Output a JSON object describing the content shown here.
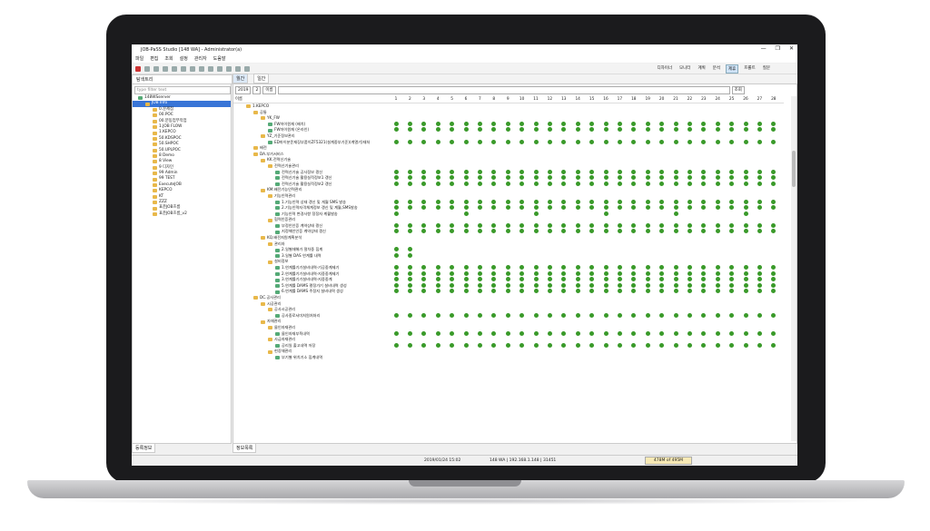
{
  "window": {
    "title": "JOB-PaSS Studio [148 WA] - Administrator(a)",
    "min": "—",
    "max": "❐",
    "close": "✕"
  },
  "menu": [
    "파일",
    "편집",
    "조회",
    "설정",
    "관리자",
    "도움말"
  ],
  "perspectives": [
    {
      "label": "디자이너",
      "active": false
    },
    {
      "label": "모니터",
      "active": false
    },
    {
      "label": "계획",
      "active": false
    },
    {
      "label": "분석",
      "active": false
    },
    {
      "label": "제휴",
      "active": true
    },
    {
      "label": "프롤트",
      "active": false
    },
    {
      "label": "질문",
      "active": false
    }
  ],
  "left_tab": {
    "label": "탐색트리"
  },
  "left_filter": {
    "placeholder": "type filter text"
  },
  "tree": [
    {
      "label": "148WSserver",
      "level": 0,
      "type": "server"
    },
    {
      "label": "JOB Info",
      "level": 1,
      "type": "folder",
      "selected": true
    },
    {
      "label": "0.문제점",
      "level": 2,
      "type": "folder"
    },
    {
      "label": "00.POC",
      "level": 2,
      "type": "folder"
    },
    {
      "label": "00.분동업무작업",
      "level": 2,
      "type": "folder"
    },
    {
      "label": "1.JOB FLOW",
      "level": 2,
      "type": "folder"
    },
    {
      "label": "1.KEPCO",
      "level": 2,
      "type": "folder"
    },
    {
      "label": "50.KDSPOC",
      "level": 2,
      "type": "folder"
    },
    {
      "label": "50.SHPOC",
      "level": 2,
      "type": "folder"
    },
    {
      "label": "50.UPLPOC",
      "level": 2,
      "type": "folder"
    },
    {
      "label": "8 Demo",
      "level": 2,
      "type": "folder"
    },
    {
      "label": "8 View",
      "level": 2,
      "type": "folder"
    },
    {
      "label": "9 디자인",
      "level": 2,
      "type": "folder"
    },
    {
      "label": "99 Admin",
      "level": 2,
      "type": "folder"
    },
    {
      "label": "99 TEST",
      "level": 2,
      "type": "folder"
    },
    {
      "label": "ExecuteJOB",
      "level": 2,
      "type": "folder"
    },
    {
      "label": "KEPCO",
      "level": 2,
      "type": "folder"
    },
    {
      "label": "KT",
      "level": 2,
      "type": "folder"
    },
    {
      "label": "ZZZ",
      "level": 2,
      "type": "folder"
    },
    {
      "label": "표준JOB흐름",
      "level": 2,
      "type": "folder"
    },
    {
      "label": "표준JOB흐름_v2",
      "level": 2,
      "type": "folder"
    }
  ],
  "main_tabs": [
    {
      "label": "월간",
      "active": true
    },
    {
      "label": "일간",
      "active": false
    }
  ],
  "filters": {
    "year": "2019",
    "month": "2",
    "scope": "이름",
    "search_button": "조회"
  },
  "grid": {
    "name_header": "이름",
    "days": [
      "1",
      "2",
      "3",
      "4",
      "5",
      "6",
      "7",
      "8",
      "9",
      "10",
      "11",
      "12",
      "13",
      "14",
      "15",
      "16",
      "17",
      "18",
      "19",
      "20",
      "21",
      "22",
      "23",
      "24",
      "25",
      "26",
      "27",
      "28"
    ],
    "rows": [
      {
        "label": "1.KEPCO",
        "level": 0,
        "type": "folder",
        "marks": ""
      },
      {
        "label": "공통",
        "level": 1,
        "type": "folder",
        "marks": ""
      },
      {
        "label": "YK_FW",
        "level": 2,
        "type": "folder",
        "marks": ""
      },
      {
        "label": "FW마이원재 (배치)",
        "level": 3,
        "type": "job",
        "marks": "1111111111111111111111111111"
      },
      {
        "label": "FW마이원재 (온라인)",
        "level": 3,
        "type": "job",
        "marks": "1111111111111111111111111111"
      },
      {
        "label": "YZ_기준정보관리",
        "level": 2,
        "type": "folder",
        "marks": ""
      },
      {
        "label": "ED마이분운재징부품이ZF5321(설계중부기준)(계열기)재처",
        "level": 3,
        "type": "job",
        "marks": "1111111111111111111111111111"
      },
      {
        "label": "배전",
        "level": 1,
        "type": "folder",
        "marks": ""
      },
      {
        "label": "DA.부가서비스",
        "level": 1,
        "type": "folder",
        "marks": ""
      },
      {
        "label": "KK.전력신기술",
        "level": 2,
        "type": "folder",
        "marks": ""
      },
      {
        "label": "전력신기술관리",
        "level": 3,
        "type": "folder",
        "marks": ""
      },
      {
        "label": "전력신기술 공사정보 갱신",
        "level": 4,
        "type": "job",
        "marks": "1111111111111111111111111111"
      },
      {
        "label": "전력신기술 활용실적정보1 갱신",
        "level": 4,
        "type": "job",
        "marks": "1111111111111111111111111111"
      },
      {
        "label": "전력신기술 활용실적정보2 갱신",
        "level": 4,
        "type": "job",
        "marks": "1111111111111111111111111111"
      },
      {
        "label": "KM.배전기능인력관리",
        "level": 2,
        "type": "folder",
        "marks": ""
      },
      {
        "label": "기능인력관리",
        "level": 3,
        "type": "folder",
        "marks": ""
      },
      {
        "label": "1.기능인력 상태 갱신 및 게월 SMS 발송",
        "level": 4,
        "type": "job",
        "marks": "1111111111111111111111111111"
      },
      {
        "label": "2.기능인력자격체계정보 갱신 및 계월,SMS발송",
        "level": 4,
        "type": "job",
        "marks": "1111111111111111111111111111"
      },
      {
        "label": "기능인력 변경사항 정정자 계월발송",
        "level": 4,
        "type": "job",
        "marks": "1000010000100001000010000100"
      },
      {
        "label": "협력인증관리",
        "level": 3,
        "type": "folder",
        "marks": ""
      },
      {
        "label": "부정인인증 계약상태 갱신",
        "level": 4,
        "type": "job",
        "marks": "1111111111111111111111111111"
      },
      {
        "label": "지정해인인증 계약상태 갱신",
        "level": 4,
        "type": "job",
        "marks": "1111111111111111111111111111"
      },
      {
        "label": "KQ.배전자원계획분석",
        "level": 2,
        "type": "folder",
        "marks": ""
      },
      {
        "label": "관리자",
        "level": 3,
        "type": "folder",
        "marks": ""
      },
      {
        "label": "2.일별재해가 절차중 집계",
        "level": 4,
        "type": "job",
        "marks": "1100000000000000000000000000"
      },
      {
        "label": "3.일별 DAS 연계률 내역",
        "level": 4,
        "type": "job",
        "marks": "1100000000000000000000000000"
      },
      {
        "label": "설비정보",
        "level": 3,
        "type": "folder",
        "marks": ""
      },
      {
        "label": "1.연계률기기설비내역-기공중계제기",
        "level": 4,
        "type": "job",
        "marks": "1111111111111111111111111111"
      },
      {
        "label": "2.연계률기기설비내역-지중중계제기",
        "level": 4,
        "type": "job",
        "marks": "1111111111111111111111111111"
      },
      {
        "label": "3.연계률기기설비내역-지중중계",
        "level": 4,
        "type": "job",
        "marks": "1111111111111111111111111111"
      },
      {
        "label": "5.연계률 DAMS 평정가기 설비내역 생성",
        "level": 4,
        "type": "job",
        "marks": "1111111111111111111111111111"
      },
      {
        "label": "6.연계률 DAMS 주정지 설비내역 생성",
        "level": 4,
        "type": "job",
        "marks": "1111111111111111111111111111"
      },
      {
        "label": "DC.공사관리",
        "level": 1,
        "type": "folder",
        "marks": ""
      },
      {
        "label": "시공관리",
        "level": 2,
        "type": "folder",
        "marks": ""
      },
      {
        "label": "공사시공관리",
        "level": 3,
        "type": "folder",
        "marks": ""
      },
      {
        "label": "공사중로서미처원처처리",
        "level": 4,
        "type": "job",
        "marks": "1111111111111111111111111111"
      },
      {
        "label": "자재관리",
        "level": 2,
        "type": "folder",
        "marks": ""
      },
      {
        "label": "물인자재관리",
        "level": 3,
        "type": "folder",
        "marks": ""
      },
      {
        "label": "물인자재부족내역",
        "level": 4,
        "type": "job",
        "marks": "1111111111111111111111111111"
      },
      {
        "label": "사급자재관리",
        "level": 3,
        "type": "folder",
        "marks": ""
      },
      {
        "label": "공리일 출고내역 저장",
        "level": 4,
        "type": "job",
        "marks": "1111111111111111111111111111"
      },
      {
        "label": "현장재관리",
        "level": 3,
        "type": "folder",
        "marks": ""
      },
      {
        "label": "부기별 위치기소 집계내역",
        "level": 4,
        "type": "job",
        "marks": ""
      }
    ]
  },
  "bottom": {
    "left_tab": "등록정보",
    "right_tab": "정보목록"
  },
  "status": {
    "datetime": "2019/01/24 15:02",
    "server": "148 WA | 192.168.1.148 | 31451",
    "memory": "478M of 495M"
  },
  "colors": {
    "check": "#3a9a2a",
    "folder": "#e8b84a",
    "selected": "#3875d7"
  }
}
